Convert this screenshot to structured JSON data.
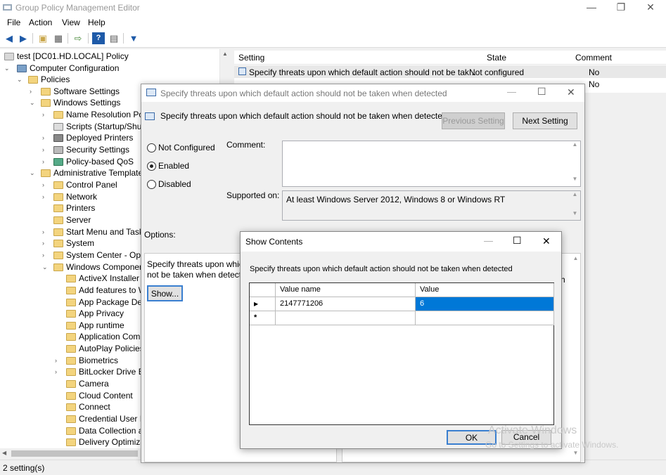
{
  "window": {
    "title": "Group Policy Management Editor"
  },
  "menu": [
    "File",
    "Action",
    "View",
    "Help"
  ],
  "tree": {
    "root": "test [DC01.HD.LOCAL] Policy",
    "computer_config": "Computer Configuration",
    "policies": "Policies",
    "software_settings": "Software Settings",
    "windows_settings": "Windows Settings",
    "name_resolution": "Name Resolution Poli",
    "scripts": "Scripts (Startup/Shutc",
    "deployed_printers": "Deployed Printers",
    "security_settings": "Security Settings",
    "policy_qos": "Policy-based QoS",
    "admin_templates": "Administrative Templates",
    "control_panel": "Control Panel",
    "network": "Network",
    "printers": "Printers",
    "server": "Server",
    "start_menu": "Start Menu and Taskb",
    "system": "System",
    "system_center": "System Center - Oper",
    "windows_components": "Windows Component",
    "activex": "ActiveX Installer S",
    "add_features": "Add features to W",
    "app_package": "App Package Depl",
    "app_privacy": "App Privacy",
    "app_runtime": "App runtime",
    "app_compat": "Application Comp",
    "autoplay": "AutoPlay Policies",
    "biometrics": "Biometrics",
    "bitlocker": "BitLocker Drive En",
    "camera": "Camera",
    "cloud_content": "Cloud Content",
    "connect": "Connect",
    "credential": "Credential User Int",
    "data_collection": "Data Collection ar",
    "delivery": "Delivery Optimizat"
  },
  "list": {
    "columns": {
      "setting": "Setting",
      "state": "State",
      "comment": "Comment"
    },
    "rows": [
      {
        "setting": "Specify threats upon which default action should not be tak...",
        "state": "Not configured",
        "comment": "No"
      },
      {
        "setting": "",
        "state": "",
        "comment": "No"
      }
    ]
  },
  "status": "2 setting(s)",
  "policy_dialog": {
    "title": "Specify threats upon which default action should not be taken when detected",
    "header": "Specify threats upon which default action should not be taken when detected",
    "prev_btn": "Previous Setting",
    "next_btn": "Next Setting",
    "radio_not_configured": "Not Configured",
    "radio_enabled": "Enabled",
    "radio_disabled": "Disabled",
    "comment_label": "Comment:",
    "supported_label": "Supported on:",
    "supported_value": "At least Windows Server 2012, Windows 8 or Windows RT",
    "options_label": "Options:",
    "options_text_1": "Specify threats upon which",
    "options_text_2": "not be taken when detected",
    "show_btn": "Show...",
    "help_partial": "h"
  },
  "show_contents": {
    "title": "Show Contents",
    "description": "Specify threats upon which default action should not be taken when detected",
    "col_name": "Value name",
    "col_value": "Value",
    "row_name": "2147771206",
    "row_value": "6",
    "current_marker": "▶",
    "new_marker": "*",
    "ok": "OK",
    "cancel": "Cancel"
  },
  "watermark": {
    "line1": "Activate Windows",
    "line2": "Go to Settings to activate Windows."
  }
}
